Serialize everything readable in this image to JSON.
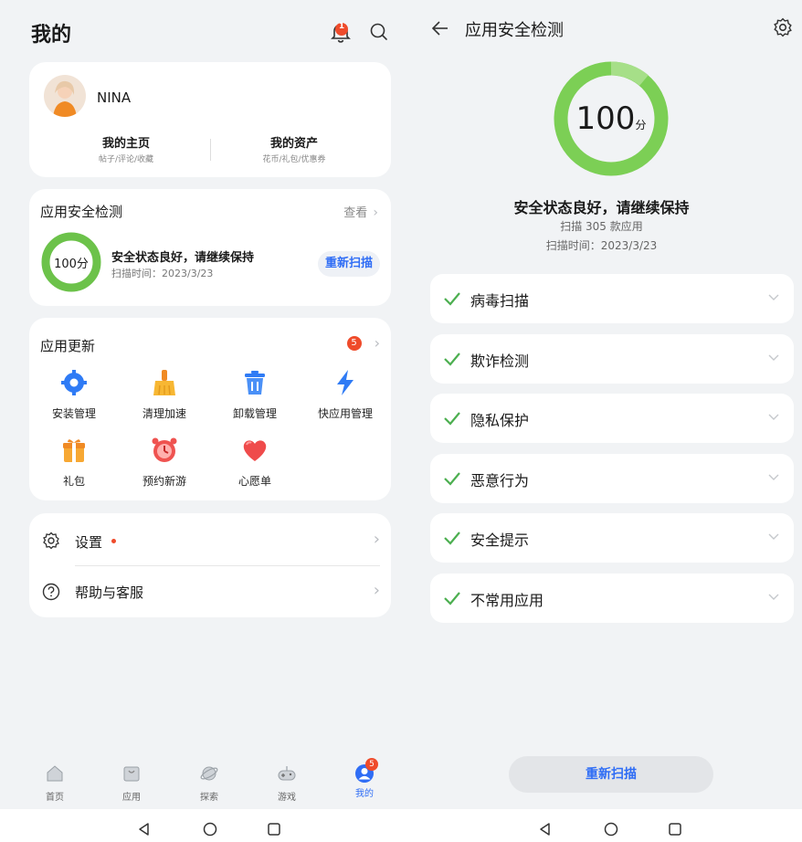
{
  "left": {
    "header": {
      "title": "我的",
      "bell_badge": "1"
    },
    "profile": {
      "username": "NINA",
      "homepage": {
        "title": "我的主页",
        "subtitle": "帖子/评论/收藏"
      },
      "assets": {
        "title": "我的资产",
        "subtitle": "花币/礼包/优惠券"
      }
    },
    "security_card": {
      "title": "应用安全检测",
      "view_label": "查看",
      "score": "100分",
      "status": "安全状态良好，请继续保持",
      "scan_time": "扫描时间：2023/3/23",
      "rescan_label": "重新扫描"
    },
    "updates_card": {
      "title": "应用更新",
      "badge": "5",
      "items": [
        {
          "label": "安装管理",
          "icon": "gear-icon",
          "color": "#2f7bf5"
        },
        {
          "label": "清理加速",
          "icon": "broom-icon",
          "color": "#f5a623"
        },
        {
          "label": "卸载管理",
          "icon": "trash-icon",
          "color": "#2f7bf5"
        },
        {
          "label": "快应用管理",
          "icon": "lightning-icon",
          "color": "#2f7bf5"
        },
        {
          "label": "礼包",
          "icon": "gift-icon",
          "color": "#f5a623"
        },
        {
          "label": "预约新游",
          "icon": "alarm-clock-icon",
          "color": "#ef4b4b"
        },
        {
          "label": "心愿单",
          "icon": "heart-icon",
          "color": "#ef4b4b"
        }
      ]
    },
    "settings_card": {
      "settings_label": "设置",
      "help_label": "帮助与客服"
    },
    "tabbar": {
      "tabs": [
        {
          "label": "首页",
          "icon": "home-icon"
        },
        {
          "label": "应用",
          "icon": "shopping-bag-icon"
        },
        {
          "label": "探索",
          "icon": "planet-icon"
        },
        {
          "label": "游戏",
          "icon": "gamepad-icon"
        },
        {
          "label": "我的",
          "icon": "user-icon"
        }
      ],
      "me_badge": "5",
      "active_color": "#2f6df5"
    }
  },
  "right": {
    "header": {
      "title": "应用安全检测"
    },
    "score": {
      "value": "100",
      "unit": "分"
    },
    "status": "安全状态良好，请继续保持",
    "scanned_apps": "扫描 305 款应用",
    "scan_time": "扫描时间：2023/3/23",
    "checks": [
      "病毒扫描",
      "欺诈检测",
      "隐私保护",
      "恶意行为",
      "安全提示",
      "不常用应用"
    ],
    "rescan_label": "重新扫描",
    "accent": "#4caf50",
    "link_color": "#2f6df5"
  }
}
